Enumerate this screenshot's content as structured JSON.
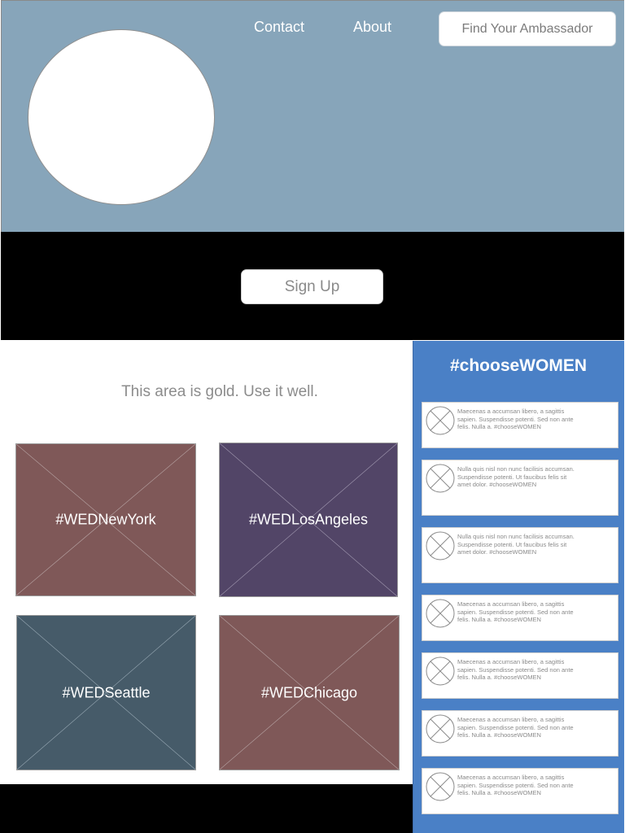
{
  "header": {
    "nav": {
      "contact": "Contact",
      "about": "About"
    },
    "ambassador_button": "Find Your Ambassador"
  },
  "signup": {
    "button": "Sign Up"
  },
  "main": {
    "tagline": "This area is gold. Use it well.",
    "tiles": [
      {
        "label": "#WEDNewYork",
        "color": "#7f5858"
      },
      {
        "label": "#WEDLosAngeles",
        "color": "#524567"
      },
      {
        "label": "#WEDSeattle",
        "color": "#465b69"
      },
      {
        "label": "#WEDChicago",
        "color": "#7f5858"
      }
    ]
  },
  "sidebar": {
    "title": "#chooseWOMEN",
    "color": "#4a80c6",
    "posts": [
      {
        "avatar": "placeholder-image-icon",
        "text": "Maecenas a accumsan libero, a sagittis sapien. Suspendisse potenti. Sed non ante felis. Nulla a. #chooseWOMEN"
      },
      {
        "avatar": "placeholder-image-icon",
        "text": "Nulla quis nisl non nunc facilisis accumsan. Suspendisse potenti. Ut faucibus felis sit amet dolor. #chooseWOMEN"
      },
      {
        "avatar": "placeholder-image-icon",
        "text": "Nulla quis nisl non nunc facilisis accumsan. Suspendisse potenti. Ut faucibus felis sit amet dolor. #chooseWOMEN"
      },
      {
        "avatar": "placeholder-image-icon",
        "text": "Maecenas a accumsan libero, a sagittis sapien. Suspendisse potenti. Sed non ante felis. Nulla a. #chooseWOMEN"
      },
      {
        "avatar": "placeholder-image-icon",
        "text": "Maecenas a accumsan libero, a sagittis sapien. Suspendisse potenti. Sed non ante felis. Nulla a. #chooseWOMEN"
      },
      {
        "avatar": "placeholder-image-icon",
        "text": "Maecenas a accumsan libero, a sagittis sapien. Suspendisse potenti. Sed non ante felis. Nulla a. #chooseWOMEN"
      },
      {
        "avatar": "placeholder-image-icon",
        "text": "Maecenas a accumsan libero, a sagittis sapien. Suspendisse potenti. Sed non ante felis. Nulla a. #chooseWOMEN"
      }
    ]
  }
}
